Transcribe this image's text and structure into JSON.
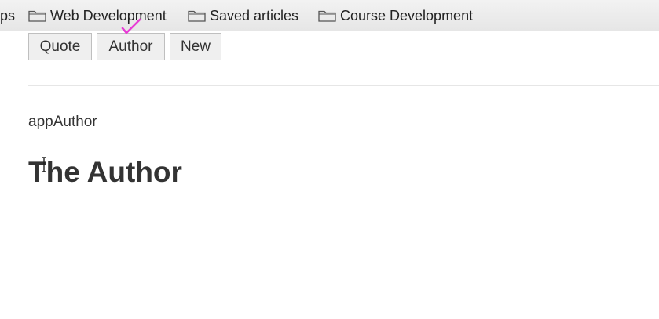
{
  "bookmarks": {
    "partial_item": "ps",
    "items": [
      {
        "label": "Web Development",
        "icon": "folder-icon"
      },
      {
        "label": "Saved articles",
        "icon": "folder-icon"
      },
      {
        "label": "Course Development",
        "icon": "folder-icon"
      }
    ]
  },
  "nav": {
    "quote_label": "Quote",
    "author_label": "Author",
    "new_label": "New"
  },
  "content": {
    "component_text": "appAuthor",
    "heading": "The Author"
  },
  "annotation": {
    "icon": "checkmark-icon",
    "color": "#e83cd6"
  }
}
